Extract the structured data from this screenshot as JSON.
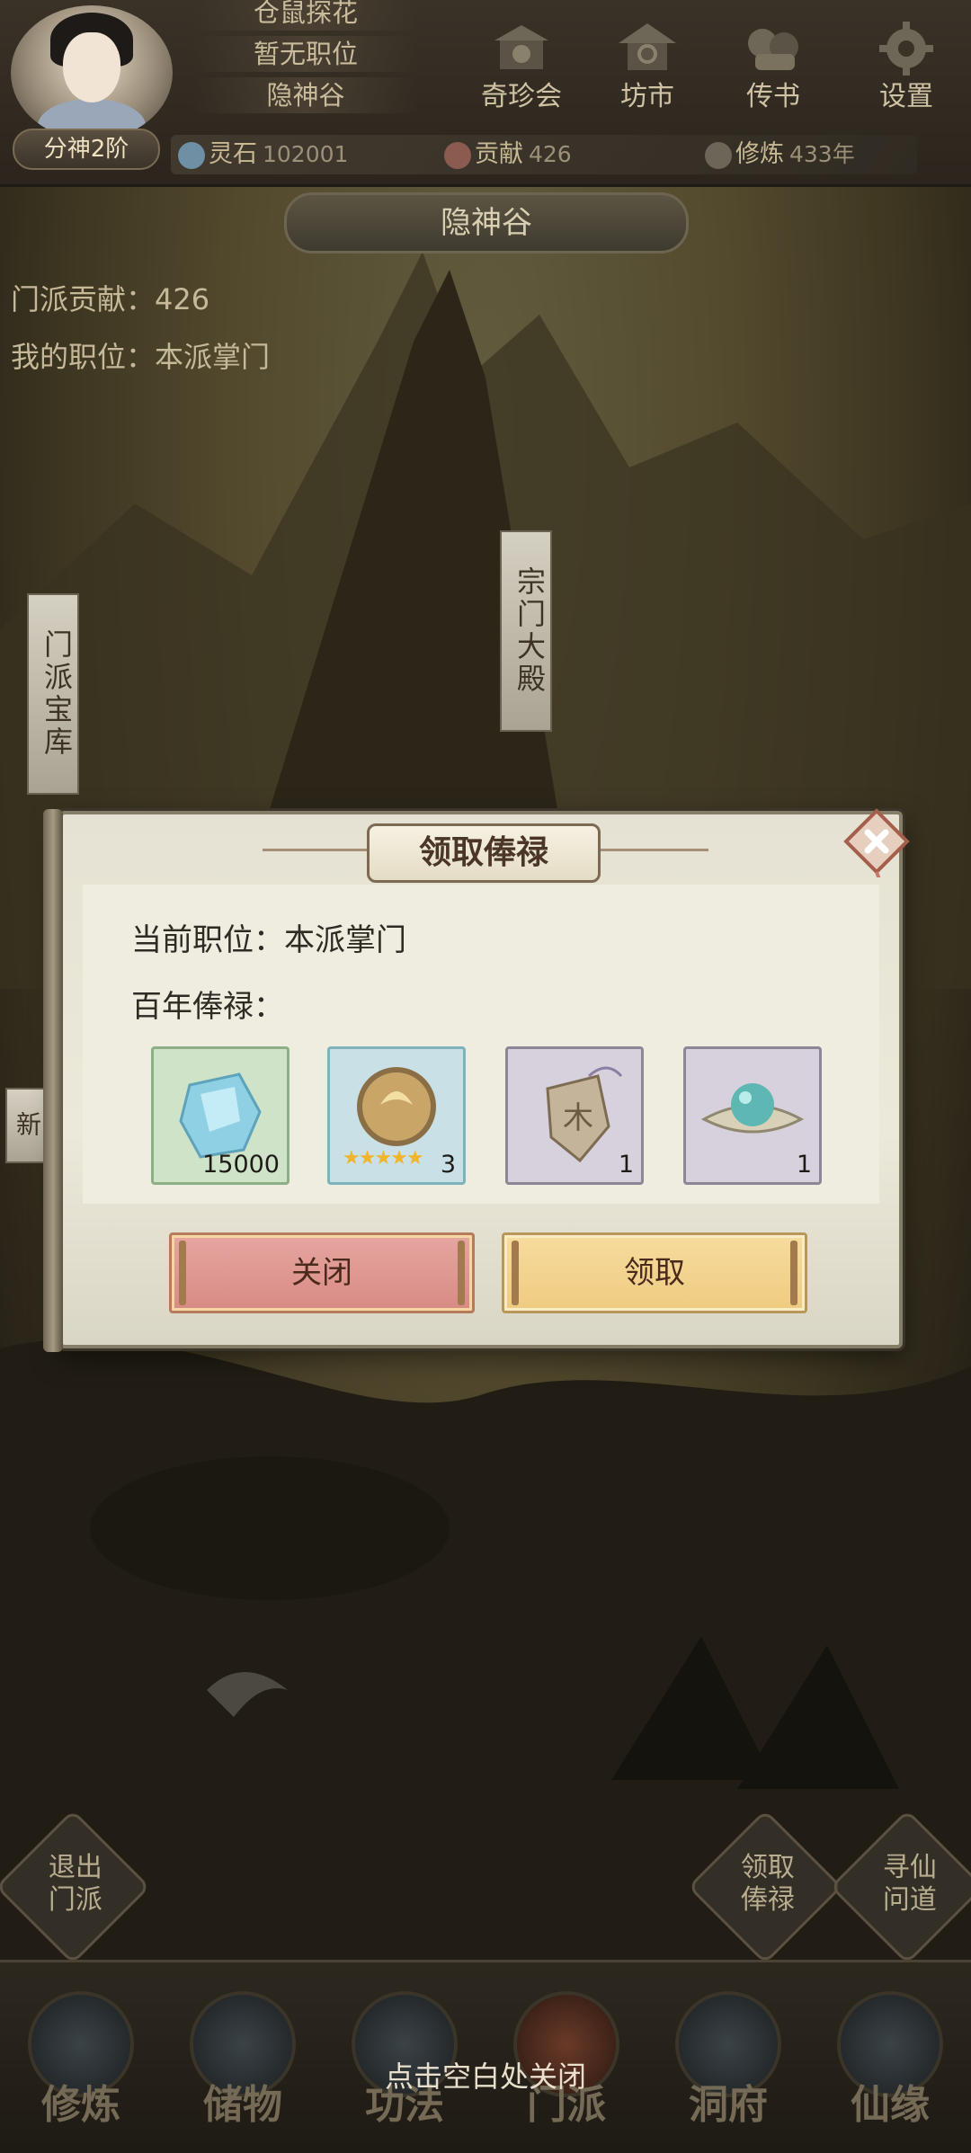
{
  "player": {
    "title_top": "仓鼠探花",
    "position": "暂无职位",
    "sect_name": "隐神谷",
    "rank": "分神2阶"
  },
  "top_nav": [
    {
      "label": "奇珍会",
      "icon": "treasure-pavilion-icon"
    },
    {
      "label": "坊市",
      "icon": "market-icon"
    },
    {
      "label": "传书",
      "icon": "letter-icon"
    },
    {
      "label": "设置",
      "icon": "gear-icon"
    }
  ],
  "resources": {
    "spirit_stone": {
      "label": "灵石",
      "value": "102001"
    },
    "contribution": {
      "label": "贡献",
      "value": "426"
    },
    "cultivation": {
      "label": "修炼",
      "value": "433年"
    }
  },
  "location": "隐神谷",
  "sect_info": {
    "contribution": "门派贡献：426",
    "my_position": "我的职位：本派掌门"
  },
  "banners": {
    "treasury": "门派宝库",
    "main_hall": "宗门大殿",
    "new": "新"
  },
  "dialog": {
    "title": "领取俸禄",
    "current_position": "当前职位：本派掌门",
    "salary_label": "百年俸禄：",
    "rewards": [
      {
        "icon": "spirit-crystal-icon",
        "qty": "15000",
        "frame": "#cfe3c8"
      },
      {
        "icon": "golden-orb-icon",
        "qty": "3",
        "stars": "★★★★★",
        "frame": "#c9e1e6"
      },
      {
        "icon": "talisman-icon",
        "qty": "1",
        "frame": "#d6d1dc"
      },
      {
        "icon": "jade-bead-icon",
        "qty": "1",
        "frame": "#d6d1dc"
      }
    ],
    "close_button": "关闭",
    "claim_button": "领取"
  },
  "side_buttons": {
    "leave": "退出\n门派",
    "salary": "领取\n俸禄",
    "seek": "寻仙\n问道"
  },
  "bottom_nav": [
    {
      "label": "修炼"
    },
    {
      "label": "储物"
    },
    {
      "label": "功法"
    },
    {
      "label": "门派"
    },
    {
      "label": "洞府"
    },
    {
      "label": "仙缘"
    }
  ],
  "hint": "点击空白处关闭",
  "colors": {
    "accent_gold": "#eecb80",
    "accent_red": "#d88a84",
    "star": "#f0b52a"
  }
}
